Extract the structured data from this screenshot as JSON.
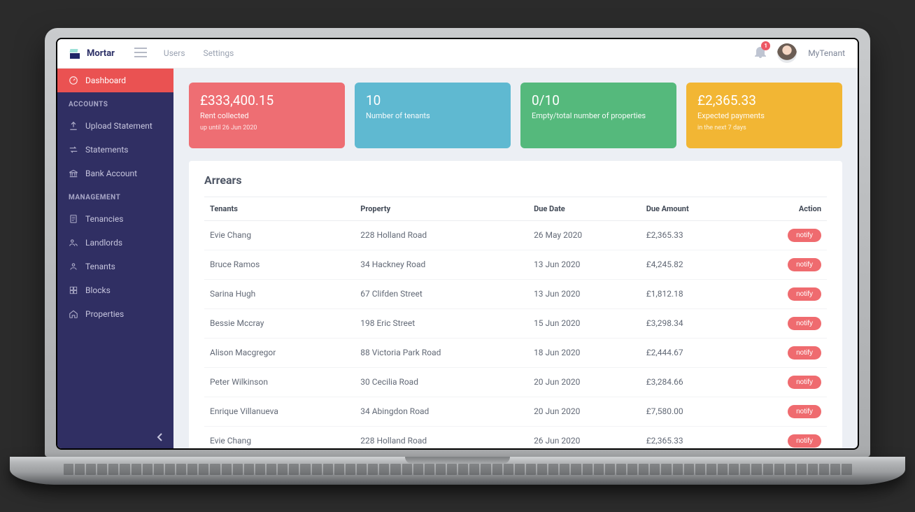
{
  "brand": "Mortar",
  "topnav": {
    "users": "Users",
    "settings": "Settings"
  },
  "notifications_count": "1",
  "current_user": "MyTenant",
  "sidebar": {
    "dashboard": "Dashboard",
    "accounts_header": "ACCOUNTS",
    "management_header": "MANAGEMENT",
    "items": {
      "upload_statement": "Upload Statement",
      "statements": "Statements",
      "bank_account": "Bank Account",
      "tenancies": "Tenancies",
      "landlords": "Landlords",
      "tenants": "Tenants",
      "blocks": "Blocks",
      "properties": "Properties"
    }
  },
  "cards": {
    "rent": {
      "value": "£333,400.15",
      "label": "Rent collected",
      "note": "up until 26 Jun 2020"
    },
    "tenants": {
      "value": "10",
      "label": "Number of tenants"
    },
    "empty": {
      "value": "0/10",
      "label": "Empty/total number of properties"
    },
    "expected": {
      "value": "£2,365.33",
      "label": "Expected payments",
      "note": "in the next 7 days"
    }
  },
  "arrears": {
    "title": "Arrears",
    "columns": {
      "tenants": "Tenants",
      "property": "Property",
      "due_date": "Due Date",
      "due_amount": "Due Amount",
      "action": "Action"
    },
    "action_label": "notify",
    "rows": [
      {
        "tenant": "Evie Chang",
        "property": "228 Holland Road",
        "due_date": "26 May 2020",
        "due_amount": "£2,365.33"
      },
      {
        "tenant": "Bruce Ramos",
        "property": "34 Hackney Road",
        "due_date": "13 Jun 2020",
        "due_amount": "£4,245.82"
      },
      {
        "tenant": "Sarina Hugh",
        "property": "67 Clifden Street",
        "due_date": "13 Jun 2020",
        "due_amount": "£1,812.18"
      },
      {
        "tenant": "Bessie Mccray",
        "property": "198 Eric Street",
        "due_date": "15 Jun 2020",
        "due_amount": "£3,298.34"
      },
      {
        "tenant": "Alison Macgregor",
        "property": "88 Victoria Park Road",
        "due_date": "18 Jun 2020",
        "due_amount": "£2,444.67"
      },
      {
        "tenant": "Peter Wilkinson",
        "property": "30 Cecilia Road",
        "due_date": "20 Jun 2020",
        "due_amount": "£3,284.66"
      },
      {
        "tenant": "Enrique Villanueva",
        "property": "34 Abingdon Road",
        "due_date": "20 Jun 2020",
        "due_amount": "£7,580.00"
      },
      {
        "tenant": "Evie Chang",
        "property": "228 Holland Road",
        "due_date": "26 Jun 2020",
        "due_amount": "£2,365.33"
      }
    ]
  }
}
